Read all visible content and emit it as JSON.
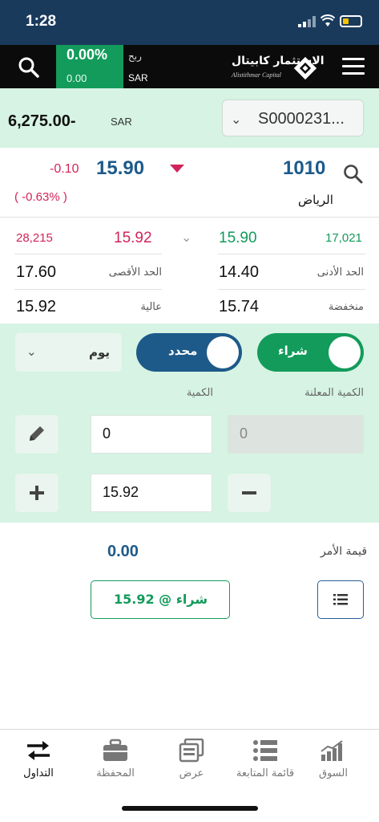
{
  "status_bar": {
    "time": "1:28"
  },
  "header": {
    "profit_pct": "0.00%",
    "profit_value": "0.00",
    "profit_label": "ربح",
    "profit_currency": "SAR",
    "logo_ar": "الاستثمار كابيتال",
    "logo_en": "Alistithmar Capital"
  },
  "account": {
    "balance": "6,275.00-",
    "currency": "SAR",
    "selected": "S0000231..."
  },
  "quote": {
    "change": "-0.10",
    "price": "15.90",
    "change_pct": "( -0.63% )",
    "symbol": "1010",
    "market": "الرياض",
    "bid_qty": "28,215",
    "bid_price": "15.92",
    "ask_price": "15.90",
    "ask_qty": "17,021",
    "high_label": "الحد الأقصى",
    "high_value": "17.60",
    "low_label": "الحد الأدنى",
    "low_value": "14.40",
    "day_high_label": "عالية",
    "day_high_value": "15.92",
    "day_low_label": "منخفضة",
    "day_low_value": "15.74"
  },
  "order": {
    "validity": "يوم",
    "order_type": "محدد",
    "side": "شراء",
    "disclosed_qty_label": "الكمية المعلنة",
    "qty_label": "الكمية",
    "disclosed_qty_value": "0",
    "qty_value": "0",
    "price_value": "15.92",
    "order_value_label": "قيمة الأمر",
    "order_value": "0.00",
    "submit_label": "شراء @ 15.92"
  },
  "bottom_nav": {
    "items": [
      {
        "label": "السوق",
        "icon": "market-chart-icon"
      },
      {
        "label": "قائمة المتابعة",
        "icon": "watchlist-icon"
      },
      {
        "label": "عرض",
        "icon": "display-icon"
      },
      {
        "label": "المحفظة",
        "icon": "portfolio-briefcase-icon"
      },
      {
        "label": "التداول",
        "icon": "trade-arrows-icon"
      }
    ]
  },
  "colors": {
    "header_bg": "#0b0b0b",
    "status_bg": "#1a3a5c",
    "green": "#139b5b",
    "red": "#d2245a",
    "blue": "#1d5a8a",
    "panel_bg": "#d6f3e3"
  }
}
